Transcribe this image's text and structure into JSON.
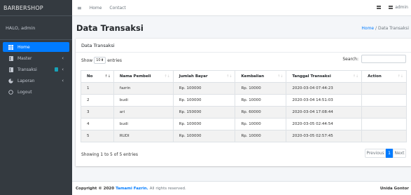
{
  "brand": "BARBERSHOP",
  "user_greeting": "HALO, admin",
  "sidebar": {
    "items": [
      {
        "label": "Home",
        "icon": "grid-icon",
        "active": true
      },
      {
        "label": "Master",
        "icon": "book-icon"
      },
      {
        "label": "Transaksi",
        "icon": "book-icon"
      },
      {
        "label": "Laporan",
        "icon": "pie-chart-icon"
      },
      {
        "label": "Logout",
        "icon": "circle-icon"
      }
    ]
  },
  "topbar": {
    "links": [
      "Home",
      "Contact"
    ],
    "user_label": "admin"
  },
  "page": {
    "title": "Data Transaksi",
    "breadcrumb_home": "Home",
    "breadcrumb_sep": " / ",
    "breadcrumb_current": "Data Transaksi"
  },
  "card": {
    "title": "Data Transaksi",
    "show_label": "Show",
    "entries_value": "10",
    "entries_label": "entries",
    "search_label": "Search:"
  },
  "table": {
    "headers": [
      "No",
      "Nama Pembeli",
      "Jumlah Bayar",
      "Kembalian",
      "Tanggal Transaksi",
      "Action"
    ],
    "rows": [
      [
        "1",
        "fazrin",
        "Rp. 100000",
        "Rp. 10000",
        "2020-03-04 07:44:23",
        ""
      ],
      [
        "2",
        "budi",
        "Rp. 100000",
        "Rp. 10000",
        "2020-03-04 14:51:03",
        ""
      ],
      [
        "3",
        "ari",
        "Rp. 150000",
        "Rp. 60000",
        "2020-03-04 17:08:44",
        ""
      ],
      [
        "4",
        "budi",
        "Rp. 100000",
        "Rp. 10000",
        "2020-03-05 02:44:54",
        ""
      ],
      [
        "5",
        "RUDI",
        "Rp. 100000",
        "Rp. 10000",
        "2020-03-05 02:57:45",
        ""
      ]
    ]
  },
  "info": "Showing 1 to 5 of 5 entries",
  "pagination": {
    "previous": "Previous",
    "current": "1",
    "next": "Next"
  },
  "footer": {
    "copyright": "Copyright © 2020",
    "author": "Tamami Fazrin.",
    "rights": "All rights reserved.",
    "right_text": "Unida Gontor"
  },
  "colors": {
    "sidebar_bg": "#343a40",
    "accent": "#007bff",
    "content_bg": "#f4f6f9"
  }
}
